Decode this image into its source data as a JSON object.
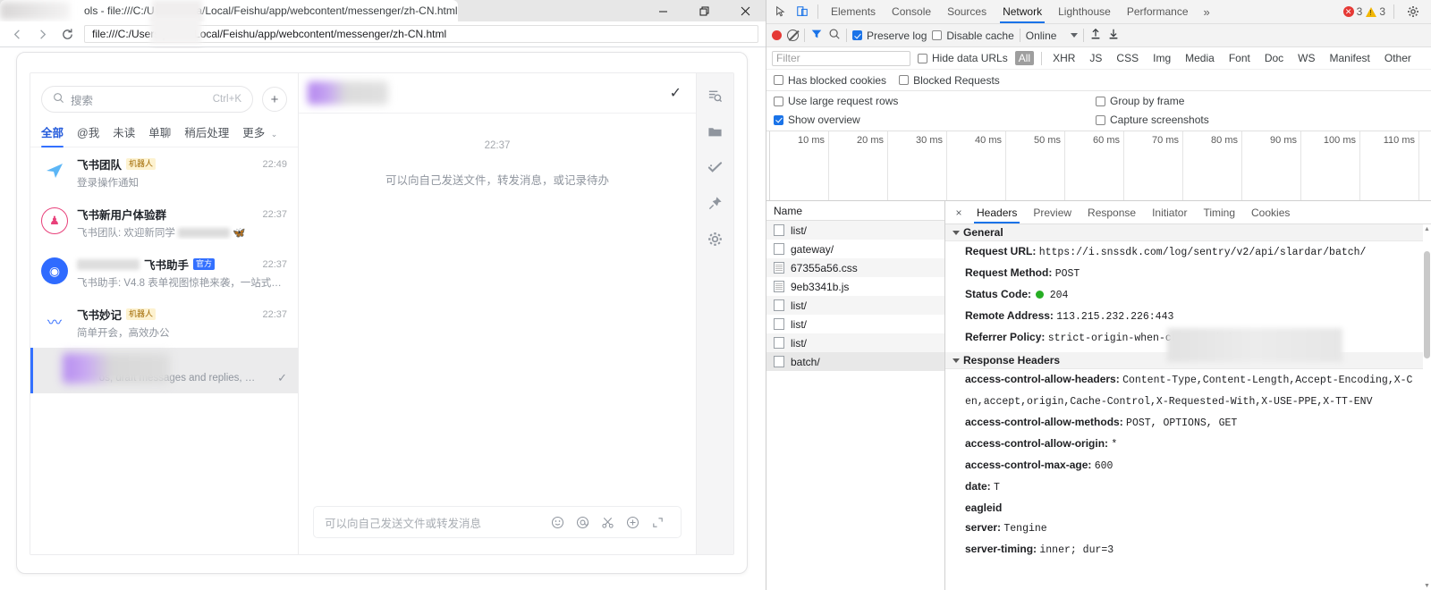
{
  "browser": {
    "tab_title": "ols - file:///C:/U              /AppData/Local/Feishu/app/webcontent/messenger/zh-CN.html",
    "url": "file:///C:/Users              pData/Local/Feishu/app/webcontent/messenger/zh-CN.html",
    "window_controls": {
      "minimize": "minimize-icon",
      "maximize": "restore-icon",
      "close": "close-icon"
    },
    "nav": {
      "back": "back-arrow-icon",
      "forward": "forward-arrow-icon",
      "reload": "reload-icon"
    }
  },
  "feishu": {
    "search": {
      "placeholder": "搜索",
      "shortcut": "Ctrl+K",
      "icon": "search-icon"
    },
    "new_chat_label": "+",
    "filters": [
      {
        "label": "全部",
        "active": true
      },
      {
        "label": "@我",
        "active": false
      },
      {
        "label": "未读",
        "active": false
      },
      {
        "label": "单聊",
        "active": false
      },
      {
        "label": "稍后处理",
        "active": false
      },
      {
        "label": "更多",
        "active": false,
        "chevron": "⌄"
      }
    ],
    "conversations": [
      {
        "name": "飞书团队",
        "badge": "机器人",
        "badge_type": "bot",
        "preview": "登录操作通知",
        "time": "22:49",
        "avatar_glyph": "➤",
        "avatar_color": "#ffffff",
        "avatar_bg": "#ffffff",
        "name_blurred": false,
        "preview_blurred": false,
        "selected": false
      },
      {
        "name": "飞书新用户体验群",
        "badge": "",
        "badge_type": "",
        "preview": "飞书团队: 欢迎新同学",
        "time": "22:37",
        "avatar_glyph": "👥",
        "avatar_color": "#e8407a",
        "avatar_bg": "#ffffff",
        "name_blurred": false,
        "preview_blurred": true,
        "selected": false
      },
      {
        "name": "飞书助手",
        "badge": "官方",
        "badge_type": "official",
        "preview": "飞书助手: V4.8 表单视图惊艳来袭，一站式解…",
        "time": "22:37",
        "avatar_glyph": "◉",
        "avatar_color": "#ffffff",
        "avatar_bg": "#2f6bff",
        "name_blurred": true,
        "preview_blurred": false,
        "selected": false
      },
      {
        "name": "飞书妙记",
        "badge": "机器人",
        "badge_type": "bot",
        "preview": "简单开会，高效办公",
        "time": "22:37",
        "avatar_glyph": "〰",
        "avatar_color": "#2f6bff",
        "avatar_bg": "#ffffff",
        "name_blurred": false,
        "preview_blurred": false,
        "selected": false
      },
      {
        "name": "",
        "badge": "",
        "badge_type": "",
        "preview": "os, draft messages and replies, …",
        "time": "",
        "avatar_glyph": "",
        "avatar_color": "#ffffff",
        "avatar_bg": "#b68cf0",
        "name_blurred": true,
        "preview_blurred": false,
        "selected": true
      }
    ],
    "message_pane": {
      "header_title_blurred": true,
      "header_check_icon": "checkmark-icon",
      "timestamp": "22:37",
      "hint": "可以向自己发送文件，转发消息，或记录待办",
      "composer_placeholder": "可以向自己发送文件或转发消息",
      "composer_icons": [
        "emoji-icon",
        "mention-icon",
        "scissors-icon",
        "plus-circle-icon",
        "expand-icon"
      ]
    },
    "rail_icons": [
      "search-in-chat-icon",
      "folder-icon",
      "tasks-check-icon",
      "pin-icon",
      "gear-icon"
    ]
  },
  "devtools": {
    "toolbar_icons": {
      "inspect": "inspect-element-icon",
      "device": "device-toolbar-icon",
      "settings": "gear-icon"
    },
    "panels": [
      {
        "label": "Elements",
        "active": false
      },
      {
        "label": "Console",
        "active": false
      },
      {
        "label": "Sources",
        "active": false
      },
      {
        "label": "Network",
        "active": true
      },
      {
        "label": "Lighthouse",
        "active": false
      },
      {
        "label": "Performance",
        "active": false
      }
    ],
    "more_panels": "»",
    "error_count": "3",
    "warning_count": "3",
    "network_toolbar": {
      "record_icon": "record-icon",
      "clear_icon": "clear-icon",
      "filter_icon": "filter-funnel-icon",
      "search_icon": "search-icon",
      "preserve_log": {
        "label": "Preserve log",
        "checked": true
      },
      "disable_cache": {
        "label": "Disable cache",
        "checked": false
      },
      "throttling": "Online",
      "import_icon": "import-har-icon",
      "export_icon": "export-har-icon"
    },
    "filter": {
      "placeholder": "Filter",
      "hide_data_urls": {
        "label": "Hide data URLs",
        "checked": false
      },
      "types": [
        "All",
        "XHR",
        "JS",
        "CSS",
        "Img",
        "Media",
        "Font",
        "Doc",
        "WS",
        "Manifest",
        "Other"
      ],
      "active_type": "All",
      "has_blocked_cookies": {
        "label": "Has blocked cookies",
        "checked": false
      },
      "blocked_requests": {
        "label": "Blocked Requests",
        "checked": false
      }
    },
    "settings": {
      "use_large_request_rows": {
        "label": "Use large request rows",
        "checked": false
      },
      "group_by_frame": {
        "label": "Group by frame",
        "checked": false
      },
      "show_overview": {
        "label": "Show overview",
        "checked": true
      },
      "capture_screenshots": {
        "label": "Capture screenshots",
        "checked": false
      }
    },
    "overview_ticks": [
      "10 ms",
      "20 ms",
      "30 ms",
      "40 ms",
      "50 ms",
      "60 ms",
      "70 ms",
      "80 ms",
      "90 ms",
      "100 ms",
      "110 ms"
    ],
    "requests_header": "Name",
    "requests": [
      {
        "name": "list/",
        "icon": "checkbox-icon",
        "selected": false
      },
      {
        "name": "gateway/",
        "icon": "checkbox-icon",
        "selected": false
      },
      {
        "name": "67355a56.css",
        "icon": "document-icon",
        "selected": false
      },
      {
        "name": "9eb3341b.js",
        "icon": "document-icon",
        "selected": false
      },
      {
        "name": "list/",
        "icon": "checkbox-icon",
        "selected": false
      },
      {
        "name": "list/",
        "icon": "checkbox-icon",
        "selected": false
      },
      {
        "name": "list/",
        "icon": "checkbox-icon",
        "selected": false
      },
      {
        "name": "batch/",
        "icon": "checkbox-icon",
        "selected": true
      }
    ],
    "detail_tabs": [
      {
        "label": "Headers",
        "active": true
      },
      {
        "label": "Preview",
        "active": false
      },
      {
        "label": "Response",
        "active": false
      },
      {
        "label": "Initiator",
        "active": false
      },
      {
        "label": "Timing",
        "active": false
      },
      {
        "label": "Cookies",
        "active": false
      }
    ],
    "close_detail": "×",
    "general_section": "General",
    "general": [
      {
        "key": "Request URL:",
        "value": "https://i.snssdk.com/log/sentry/v2/api/slardar/batch/"
      },
      {
        "key": "Request Method:",
        "value": "POST"
      },
      {
        "key": "Status Code:",
        "value": "204",
        "status_dot": "#27ae24"
      },
      {
        "key": "Remote Address:",
        "value": "113.215.232.226:443"
      },
      {
        "key": "Referrer Policy:",
        "value": "strict-origin-when-cross-origin"
      }
    ],
    "response_headers_section": "Response Headers",
    "response_headers": [
      {
        "key": "access-control-allow-headers:",
        "value": "Content-Type,Content-Length,Accept-Encoding,X-C",
        "value_line2": "en,accept,origin,Cache-Control,X-Requested-With,X-USE-PPE,X-TT-ENV",
        "redacted": false
      },
      {
        "key": "access-control-allow-methods:",
        "value": "POST, OPTIONS, GET",
        "redacted": false
      },
      {
        "key": "access-control-allow-origin:",
        "value": "*",
        "redacted": false
      },
      {
        "key": "access-control-max-age:",
        "value": "600",
        "redacted": false
      },
      {
        "key": "date:",
        "value": "T",
        "redacted": true
      },
      {
        "key": "eagleid",
        "value": "",
        "redacted": true
      },
      {
        "key": "server:",
        "value": "Tengine",
        "redacted": false
      },
      {
        "key": "server-timing:",
        "value": "inner; dur=3",
        "redacted": false
      }
    ]
  }
}
